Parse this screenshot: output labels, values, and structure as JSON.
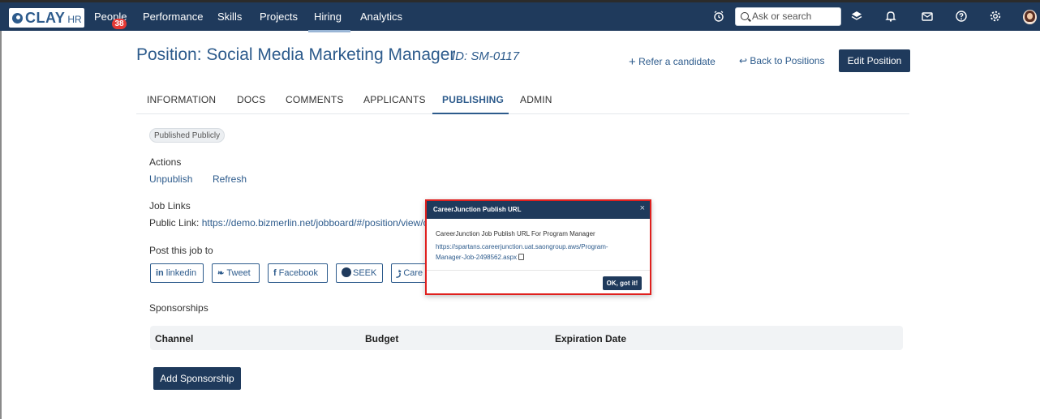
{
  "topnav": {
    "logo_text": "CLAY",
    "logo_suffix": "HR",
    "items": [
      "People",
      "Performance",
      "Skills",
      "Projects",
      "Hiring",
      "Analytics"
    ],
    "people_badge": "38",
    "search_placeholder": "Ask or search"
  },
  "header": {
    "title": "Position: Social Media Marketing Manager",
    "id": "ID: SM-0117",
    "refer": "Refer a candidate",
    "back": "Back to Positions",
    "edit": "Edit Position"
  },
  "tabs": [
    "INFORMATION",
    "DOCS",
    "COMMENTS",
    "APPLICANTS",
    "PUBLISHING",
    "ADMIN"
  ],
  "content": {
    "status": "Published Publicly",
    "actions_label": "Actions",
    "unpublish": "Unpublish",
    "refresh": "Refresh",
    "job_links_label": "Job Links",
    "public_link_label": "Public Link:",
    "public_link_url": "https://demo.bizmerlin.net/jobboard/#/position/view/c",
    "post_label": "Post this job to",
    "share": [
      "linkedin",
      "Tweet",
      "Facebook",
      "SEEK",
      "Care"
    ],
    "sponsorships_label": "Sponsorships",
    "columns": [
      "Channel",
      "Budget",
      "Expiration Date"
    ],
    "add_sponsorship": "Add Sponsorship"
  },
  "modal": {
    "title": "CareerJunction Publish URL",
    "close": "×",
    "text": "CareerJunction Job Publish URL For Program Manager",
    "url_line1": "https://spartans.careerjunction.uat.saongroup.aws/Program-",
    "url_line2": "Manager-Job-2498562.aspx",
    "ok": "OK, got it!"
  }
}
